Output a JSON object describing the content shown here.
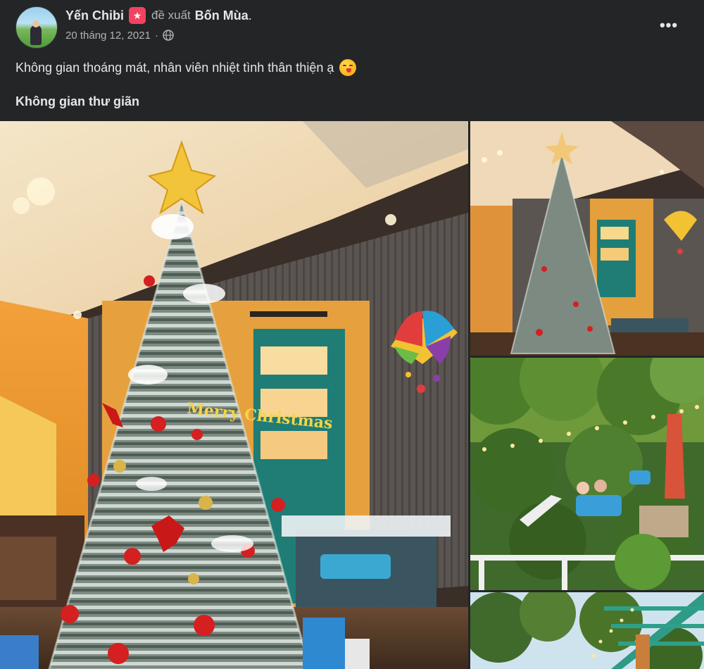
{
  "post": {
    "author": "Yến Chibi",
    "verb": "đề xuất",
    "place": "Bốn Mùa",
    "period": ".",
    "date": "20 tháng 12, 2021",
    "separator": "·",
    "privacy_icon": "globe-icon",
    "badge_icon": "star-badge-icon",
    "more_label": "•••",
    "text": "Không gian thoáng mát, nhân viên nhiệt tình thân thiện ạ",
    "text_emoji": "kissing-face-icon",
    "album_title": "Không gian thư giãn"
  },
  "photos": {
    "main": {
      "sign_text": "Merry Christmas"
    },
    "top_right": {},
    "mid_right": {},
    "bottom_right": {}
  },
  "colors": {
    "background": "#242526",
    "primary_text": "#e4e6eb",
    "secondary_text": "#b0b3b8",
    "badge": "#f3425f"
  }
}
